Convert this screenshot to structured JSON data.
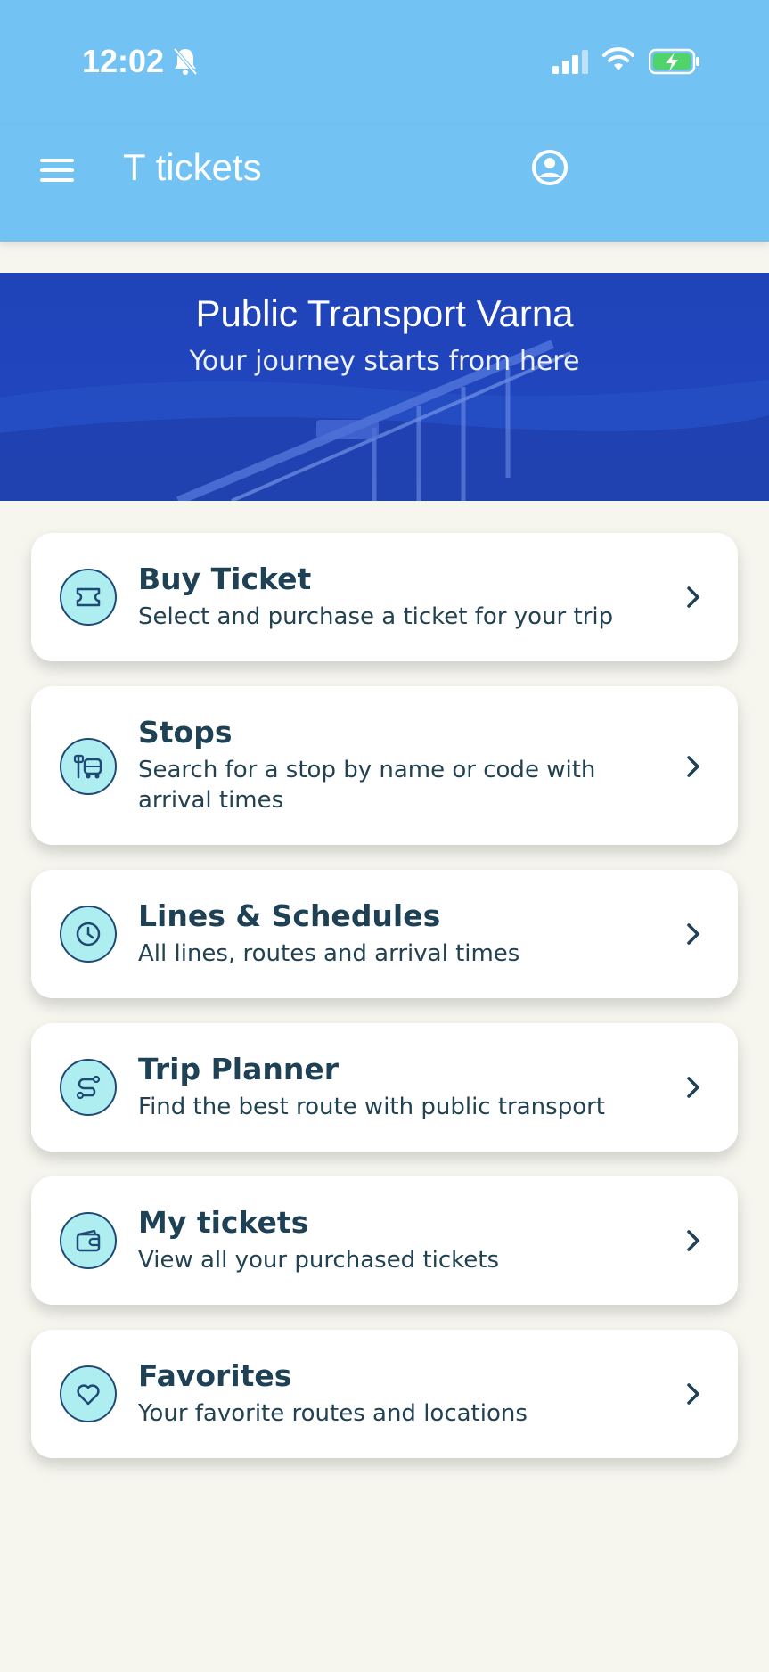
{
  "status_bar": {
    "time": "12:02"
  },
  "app_bar": {
    "title": "T tickets"
  },
  "hero": {
    "title": "Public Transport Varna",
    "subtitle": "Your journey starts from here"
  },
  "menu_cards": [
    {
      "title": "Buy Ticket",
      "description": "Select and purchase a ticket for your trip",
      "icon": "ticket-icon"
    },
    {
      "title": "Stops",
      "description": "Search for a stop by name or code with arrival times",
      "icon": "bus-stop-icon"
    },
    {
      "title": "Lines & Schedules",
      "description": "All lines, routes and arrival times",
      "icon": "clock-icon"
    },
    {
      "title": "Trip Planner",
      "description": "Find the best route with public transport",
      "icon": "route-icon"
    },
    {
      "title": "My tickets",
      "description": "View all your purchased tickets",
      "icon": "wallet-icon"
    },
    {
      "title": "Favorites",
      "description": "Your favorite routes and locations",
      "icon": "heart-icon"
    }
  ],
  "colors": {
    "header": "#72c2f4",
    "hero": "#1f3fb3",
    "background": "#f6f6ef",
    "card_text": "#1e4155",
    "icon_fill": "#aeeef0"
  }
}
